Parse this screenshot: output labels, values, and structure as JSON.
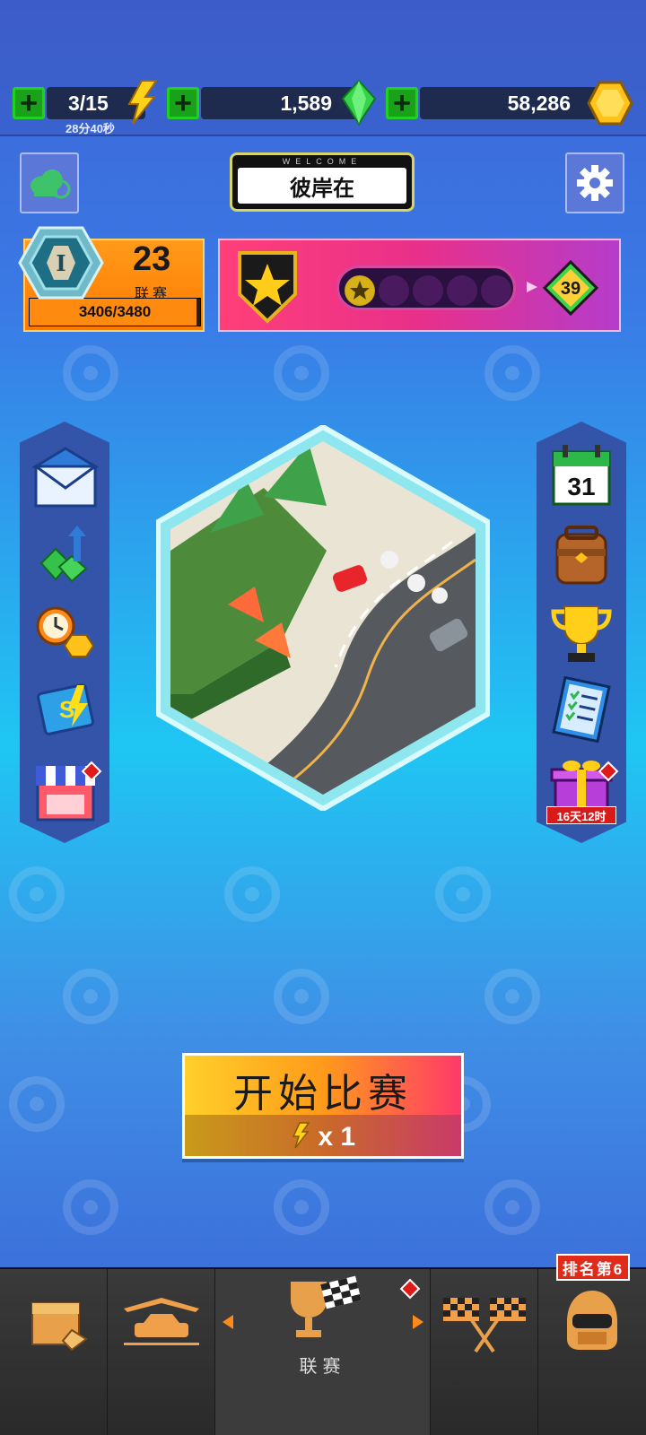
{
  "resources": {
    "energy": {
      "value": "3/15",
      "timer": "28分40秒"
    },
    "gems": {
      "value": "1,589"
    },
    "coins": {
      "value": "58,286"
    }
  },
  "welcome": {
    "top": "WELCOME",
    "name": "彼岸在"
  },
  "league": {
    "level_badge": "I",
    "number": "23",
    "label": "联赛",
    "progress_text": "3406/3480",
    "progress_fraction": 0.978
  },
  "pass": {
    "level": "39",
    "stars_filled": 1,
    "stars_total": 5
  },
  "right_rail": {
    "calendar_day": "31",
    "gift_timer": "16天12时"
  },
  "start_button": {
    "title": "开始比赛",
    "cost": "x 1"
  },
  "bottom_nav": {
    "tabs": [
      {
        "label": ""
      },
      {
        "label": ""
      },
      {
        "label": "联赛"
      },
      {
        "label": ""
      },
      {
        "label": ""
      }
    ],
    "rank_badge": "排名第6"
  },
  "colors": {
    "plus_green": "#1aa11a",
    "orange": "#ff8a10",
    "pink": "#e8308a",
    "red": "#e01a1a"
  }
}
